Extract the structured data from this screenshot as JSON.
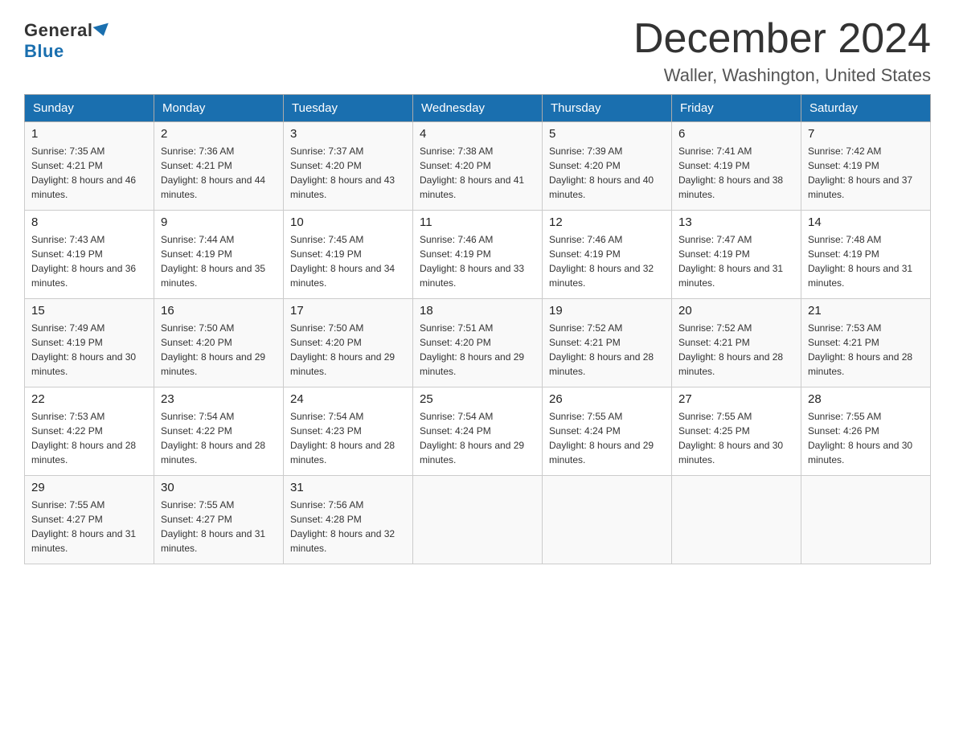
{
  "header": {
    "logo_general": "General",
    "logo_blue": "Blue",
    "month_title": "December 2024",
    "location": "Waller, Washington, United States"
  },
  "weekdays": [
    "Sunday",
    "Monday",
    "Tuesday",
    "Wednesday",
    "Thursday",
    "Friday",
    "Saturday"
  ],
  "weeks": [
    [
      {
        "day": "1",
        "sunrise": "7:35 AM",
        "sunset": "4:21 PM",
        "daylight": "8 hours and 46 minutes."
      },
      {
        "day": "2",
        "sunrise": "7:36 AM",
        "sunset": "4:21 PM",
        "daylight": "8 hours and 44 minutes."
      },
      {
        "day": "3",
        "sunrise": "7:37 AM",
        "sunset": "4:20 PM",
        "daylight": "8 hours and 43 minutes."
      },
      {
        "day": "4",
        "sunrise": "7:38 AM",
        "sunset": "4:20 PM",
        "daylight": "8 hours and 41 minutes."
      },
      {
        "day": "5",
        "sunrise": "7:39 AM",
        "sunset": "4:20 PM",
        "daylight": "8 hours and 40 minutes."
      },
      {
        "day": "6",
        "sunrise": "7:41 AM",
        "sunset": "4:19 PM",
        "daylight": "8 hours and 38 minutes."
      },
      {
        "day": "7",
        "sunrise": "7:42 AM",
        "sunset": "4:19 PM",
        "daylight": "8 hours and 37 minutes."
      }
    ],
    [
      {
        "day": "8",
        "sunrise": "7:43 AM",
        "sunset": "4:19 PM",
        "daylight": "8 hours and 36 minutes."
      },
      {
        "day": "9",
        "sunrise": "7:44 AM",
        "sunset": "4:19 PM",
        "daylight": "8 hours and 35 minutes."
      },
      {
        "day": "10",
        "sunrise": "7:45 AM",
        "sunset": "4:19 PM",
        "daylight": "8 hours and 34 minutes."
      },
      {
        "day": "11",
        "sunrise": "7:46 AM",
        "sunset": "4:19 PM",
        "daylight": "8 hours and 33 minutes."
      },
      {
        "day": "12",
        "sunrise": "7:46 AM",
        "sunset": "4:19 PM",
        "daylight": "8 hours and 32 minutes."
      },
      {
        "day": "13",
        "sunrise": "7:47 AM",
        "sunset": "4:19 PM",
        "daylight": "8 hours and 31 minutes."
      },
      {
        "day": "14",
        "sunrise": "7:48 AM",
        "sunset": "4:19 PM",
        "daylight": "8 hours and 31 minutes."
      }
    ],
    [
      {
        "day": "15",
        "sunrise": "7:49 AM",
        "sunset": "4:19 PM",
        "daylight": "8 hours and 30 minutes."
      },
      {
        "day": "16",
        "sunrise": "7:50 AM",
        "sunset": "4:20 PM",
        "daylight": "8 hours and 29 minutes."
      },
      {
        "day": "17",
        "sunrise": "7:50 AM",
        "sunset": "4:20 PM",
        "daylight": "8 hours and 29 minutes."
      },
      {
        "day": "18",
        "sunrise": "7:51 AM",
        "sunset": "4:20 PM",
        "daylight": "8 hours and 29 minutes."
      },
      {
        "day": "19",
        "sunrise": "7:52 AM",
        "sunset": "4:21 PM",
        "daylight": "8 hours and 28 minutes."
      },
      {
        "day": "20",
        "sunrise": "7:52 AM",
        "sunset": "4:21 PM",
        "daylight": "8 hours and 28 minutes."
      },
      {
        "day": "21",
        "sunrise": "7:53 AM",
        "sunset": "4:21 PM",
        "daylight": "8 hours and 28 minutes."
      }
    ],
    [
      {
        "day": "22",
        "sunrise": "7:53 AM",
        "sunset": "4:22 PM",
        "daylight": "8 hours and 28 minutes."
      },
      {
        "day": "23",
        "sunrise": "7:54 AM",
        "sunset": "4:22 PM",
        "daylight": "8 hours and 28 minutes."
      },
      {
        "day": "24",
        "sunrise": "7:54 AM",
        "sunset": "4:23 PM",
        "daylight": "8 hours and 28 minutes."
      },
      {
        "day": "25",
        "sunrise": "7:54 AM",
        "sunset": "4:24 PM",
        "daylight": "8 hours and 29 minutes."
      },
      {
        "day": "26",
        "sunrise": "7:55 AM",
        "sunset": "4:24 PM",
        "daylight": "8 hours and 29 minutes."
      },
      {
        "day": "27",
        "sunrise": "7:55 AM",
        "sunset": "4:25 PM",
        "daylight": "8 hours and 30 minutes."
      },
      {
        "day": "28",
        "sunrise": "7:55 AM",
        "sunset": "4:26 PM",
        "daylight": "8 hours and 30 minutes."
      }
    ],
    [
      {
        "day": "29",
        "sunrise": "7:55 AM",
        "sunset": "4:27 PM",
        "daylight": "8 hours and 31 minutes."
      },
      {
        "day": "30",
        "sunrise": "7:55 AM",
        "sunset": "4:27 PM",
        "daylight": "8 hours and 31 minutes."
      },
      {
        "day": "31",
        "sunrise": "7:56 AM",
        "sunset": "4:28 PM",
        "daylight": "8 hours and 32 minutes."
      },
      null,
      null,
      null,
      null
    ]
  ]
}
